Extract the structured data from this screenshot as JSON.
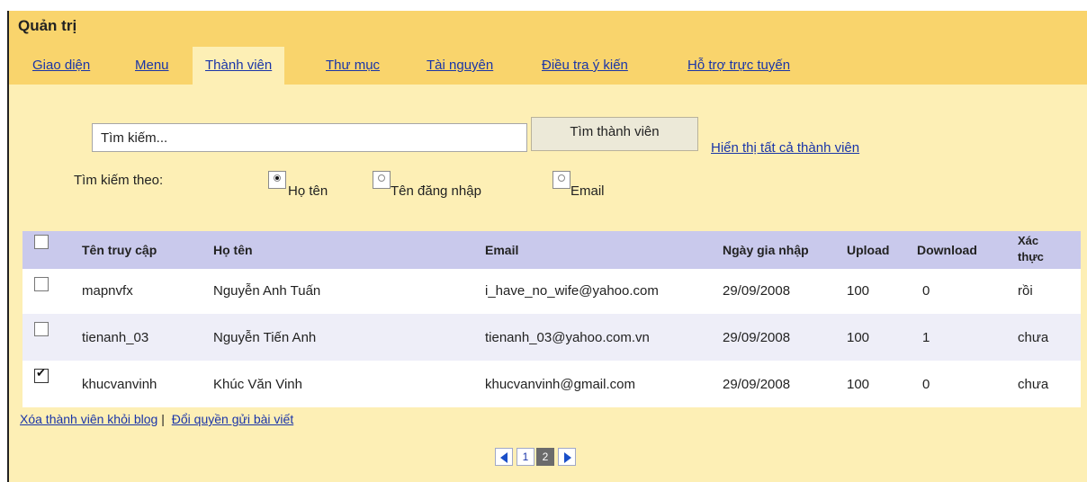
{
  "panel": {
    "title": "Quản trị"
  },
  "tabs": [
    {
      "label": "Giao diện",
      "active": false
    },
    {
      "label": "Menu",
      "active": false
    },
    {
      "label": "Thành viên",
      "active": true
    },
    {
      "label": "Thư mục",
      "active": false
    },
    {
      "label": "Tài nguyên",
      "active": false
    },
    {
      "label": "Điều tra ý kiến",
      "active": false
    },
    {
      "label": "Hỗ trợ trực tuyến",
      "active": false
    }
  ],
  "search": {
    "value": "Tìm kiếm...",
    "button_label": "Tìm thành viên",
    "show_all_link": "Hiển thị tất cả thành viên",
    "by_label": "Tìm kiếm theo:",
    "options": [
      {
        "label": "Họ tên",
        "selected": true
      },
      {
        "label": "Tên đăng nhập",
        "selected": false
      },
      {
        "label": "Email",
        "selected": false
      }
    ]
  },
  "table": {
    "headers": {
      "username": "Tên truy cập",
      "fullname": "Họ tên",
      "email": "Email",
      "joined": "Ngày gia nhập",
      "upload": "Upload",
      "download": "Download",
      "verified_1": "Xác",
      "verified_2": "thực"
    },
    "rows": [
      {
        "checked": false,
        "username": "mapnvfx",
        "fullname": "Nguyễn Anh Tuấn",
        "email": "i_have_no_wife@yahoo.com",
        "joined": "29/09/2008",
        "upload": "100",
        "download": "0",
        "verified": "rồi"
      },
      {
        "checked": false,
        "username": "tienanh_03",
        "fullname": "Nguyễn Tiến Anh",
        "email": "tienanh_03@yahoo.com.vn",
        "joined": "29/09/2008",
        "upload": "100",
        "download": "1",
        "verified": "chưa"
      },
      {
        "checked": true,
        "username": "khucvanvinh",
        "fullname": "Khúc Văn Vinh",
        "email": "khucvanvinh@gmail.com",
        "joined": "29/09/2008",
        "upload": "100",
        "download": "0",
        "verified": "chưa"
      }
    ]
  },
  "footer": {
    "remove_link": "Xóa thành viên khỏi blog",
    "separator": "|",
    "change_link": "Đổi quyền gửi bài viết"
  },
  "pagination": {
    "pages": [
      "1",
      "2"
    ],
    "current": "2"
  },
  "colors": {
    "header_bg": "#f9d46c",
    "panel_bg": "#fdefb5",
    "table_head_bg": "#c9c9ec",
    "alt_row_bg": "#eeeef8",
    "link": "#1a35a8"
  }
}
